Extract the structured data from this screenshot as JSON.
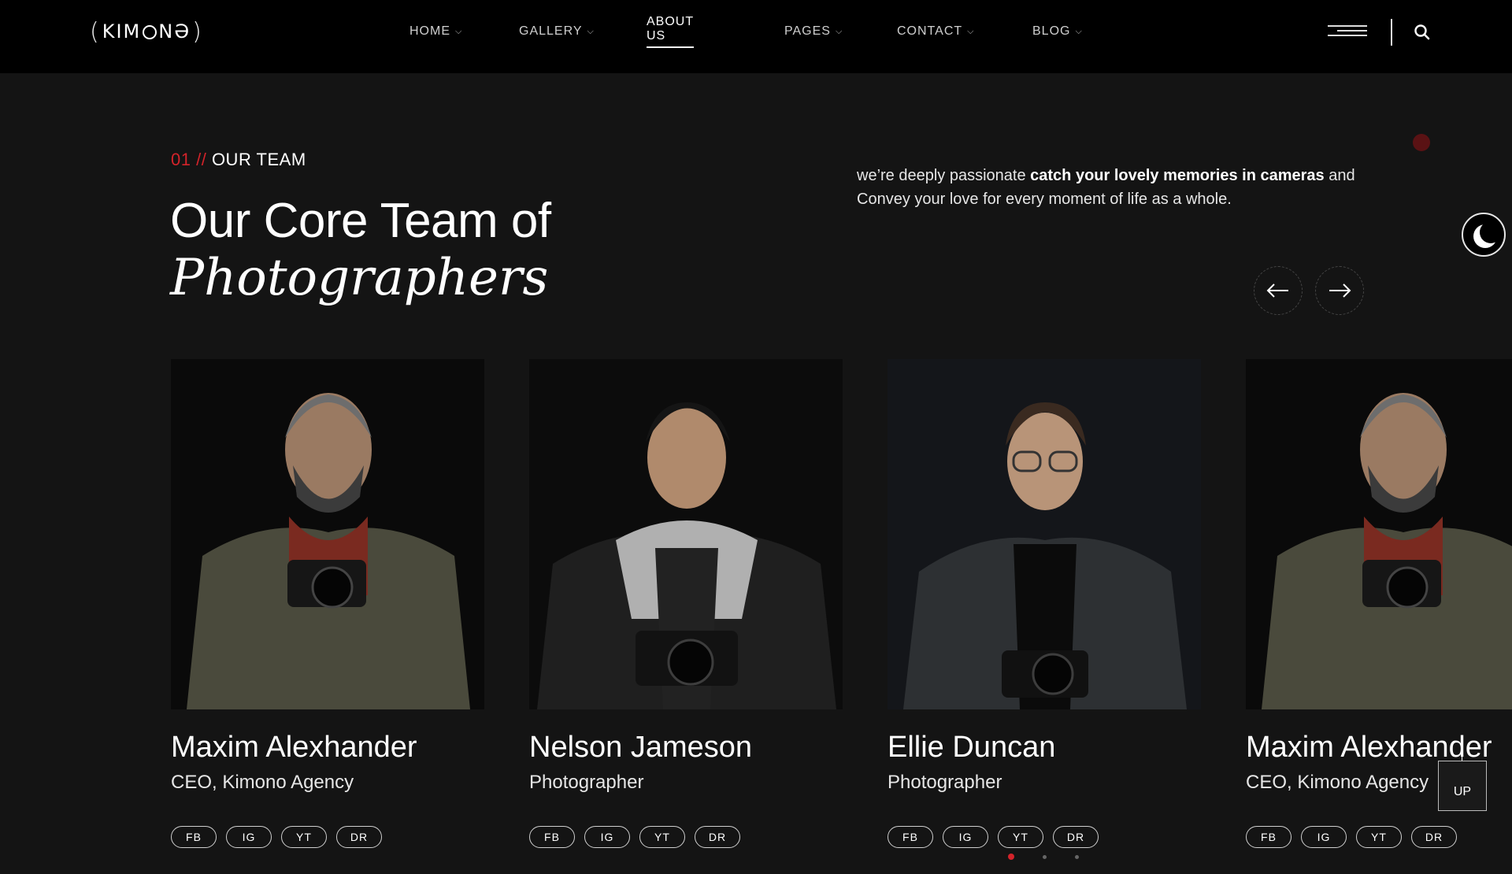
{
  "brand": {
    "logo_text": "KIMONO",
    "accent": "#d3232a"
  },
  "nav": {
    "items": [
      {
        "label": "HOME"
      },
      {
        "label": "GALLERY"
      },
      {
        "label": "ABOUT US"
      },
      {
        "label": "PAGES"
      },
      {
        "label": "CONTACT"
      },
      {
        "label": "BLOG"
      }
    ],
    "active": "ABOUT US"
  },
  "section": {
    "number": "01 //",
    "eyebrow": "OUR TEAM",
    "title": "Our Core Team of",
    "title_italic": "Photographers",
    "blurb_pre": "we’re deeply passionate ",
    "blurb_bold": "catch your lovely memories in cameras",
    "blurb_post": " and Convey your love for every moment of life as a whole."
  },
  "team": [
    {
      "name": "Maxim Alexhander",
      "role": "CEO, Kimono Agency",
      "socials": [
        "FB",
        "IG",
        "YT",
        "DR"
      ]
    },
    {
      "name": "Nelson Jameson",
      "role": "Photographer",
      "socials": [
        "FB",
        "IG",
        "YT",
        "DR"
      ]
    },
    {
      "name": "Ellie Duncan",
      "role": "Photographer",
      "socials": [
        "FB",
        "IG",
        "YT",
        "DR"
      ]
    },
    {
      "name": "Maxim Alexhander",
      "role": "CEO, Kimono Agency",
      "socials": [
        "FB",
        "IG",
        "YT",
        "DR"
      ]
    }
  ],
  "pagination": {
    "active_index": 0,
    "count": 3
  },
  "up_label": "UP"
}
